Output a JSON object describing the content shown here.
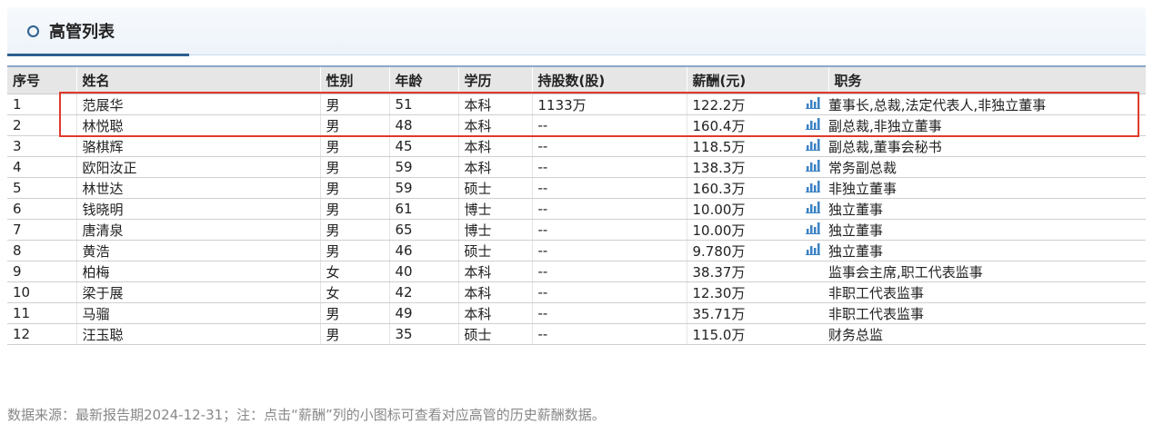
{
  "panel": {
    "title": "高管列表"
  },
  "table": {
    "headers": [
      "序号",
      "姓名",
      "性别",
      "年龄",
      "学历",
      "持股数(股)",
      "薪酬(元)",
      "职务"
    ],
    "rows": [
      {
        "no": "1",
        "name": "范展华",
        "gender": "男",
        "age": "51",
        "edu": "本科",
        "shares": "1133万",
        "salary": "122.2万",
        "has_chart": true,
        "position": "董事长,总裁,法定代表人,非独立董事"
      },
      {
        "no": "2",
        "name": "林悦聪",
        "gender": "男",
        "age": "48",
        "edu": "本科",
        "shares": "--",
        "salary": "160.4万",
        "has_chart": true,
        "position": "副总裁,非独立董事"
      },
      {
        "no": "3",
        "name": "骆棋辉",
        "gender": "男",
        "age": "45",
        "edu": "本科",
        "shares": "--",
        "salary": "118.5万",
        "has_chart": true,
        "position": "副总裁,董事会秘书"
      },
      {
        "no": "4",
        "name": "欧阳汝正",
        "gender": "男",
        "age": "59",
        "edu": "本科",
        "shares": "--",
        "salary": "138.3万",
        "has_chart": true,
        "position": "常务副总裁"
      },
      {
        "no": "5",
        "name": "林世达",
        "gender": "男",
        "age": "59",
        "edu": "硕士",
        "shares": "--",
        "salary": "160.3万",
        "has_chart": true,
        "position": "非独立董事"
      },
      {
        "no": "6",
        "name": "钱晓明",
        "gender": "男",
        "age": "61",
        "edu": "博士",
        "shares": "--",
        "salary": "10.00万",
        "has_chart": true,
        "position": "独立董事"
      },
      {
        "no": "7",
        "name": "唐清泉",
        "gender": "男",
        "age": "65",
        "edu": "博士",
        "shares": "--",
        "salary": "10.00万",
        "has_chart": true,
        "position": "独立董事"
      },
      {
        "no": "8",
        "name": "黄浩",
        "gender": "男",
        "age": "46",
        "edu": "硕士",
        "shares": "--",
        "salary": "9.780万",
        "has_chart": true,
        "position": "独立董事"
      },
      {
        "no": "9",
        "name": "柏梅",
        "gender": "女",
        "age": "40",
        "edu": "本科",
        "shares": "--",
        "salary": "38.37万",
        "has_chart": false,
        "position": "监事会主席,职工代表监事"
      },
      {
        "no": "10",
        "name": "梁于展",
        "gender": "女",
        "age": "42",
        "edu": "本科",
        "shares": "--",
        "salary": "12.30万",
        "has_chart": false,
        "position": "非职工代表监事"
      },
      {
        "no": "11",
        "name": "马骝",
        "gender": "男",
        "age": "49",
        "edu": "本科",
        "shares": "--",
        "salary": "35.71万",
        "has_chart": false,
        "position": "非职工代表监事"
      },
      {
        "no": "12",
        "name": "汪玉聪",
        "gender": "男",
        "age": "35",
        "edu": "硕士",
        "shares": "--",
        "salary": "115.0万",
        "has_chart": false,
        "position": "财务总监"
      }
    ]
  },
  "footer": {
    "note": "数据来源：最新报告期2024-12-31；注：点击“薪酬”列的小图标可查看对应高管的历史薪酬数据。"
  },
  "colors": {
    "accent": "#2f5f91",
    "highlight": "#e0392b",
    "chart_icon": "#3b82c4"
  },
  "icons": {
    "salary_chart": "bar-chart-icon",
    "bullet": "circle-bullet-icon"
  }
}
